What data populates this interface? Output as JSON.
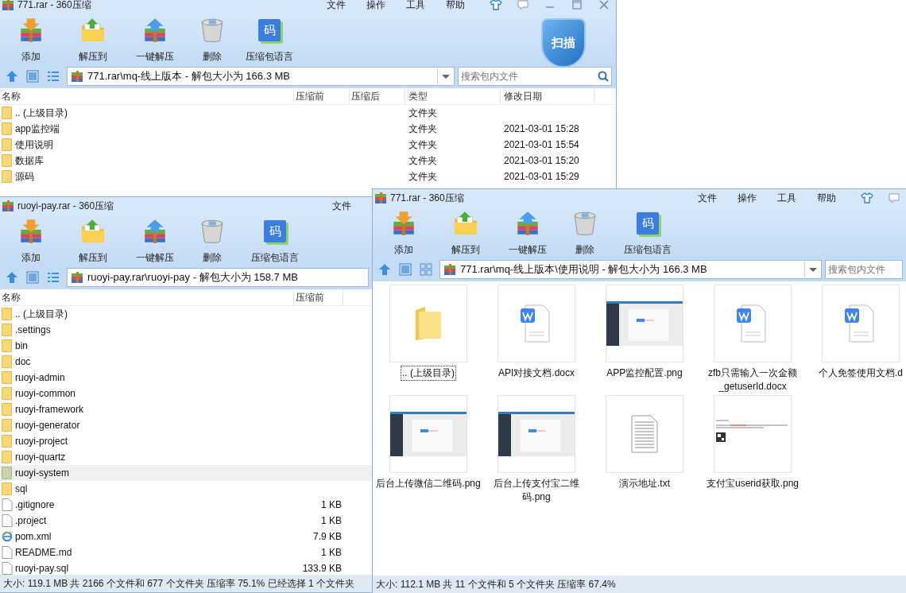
{
  "windows": [
    {
      "title": "771.rar - 360压缩",
      "menu": [
        "文件",
        "操作",
        "工具",
        "帮助"
      ],
      "title_buttons": [
        {
          "kind": "skin"
        },
        {
          "kind": "feedback"
        },
        {
          "kind": "minimize"
        },
        {
          "kind": "maximize"
        },
        {
          "kind": "close"
        }
      ],
      "toolbar": [
        {
          "label": "添加",
          "kind": "add"
        },
        {
          "label": "解压到",
          "kind": "extract"
        },
        {
          "label": "一键解压",
          "kind": "quick"
        },
        {
          "label": "删除",
          "kind": "delete"
        },
        {
          "label": "压缩包语言",
          "kind": "language",
          "glyph": "码"
        }
      ],
      "scan_badge": "扫描",
      "address": "771.rar\\mq-线上版本 - 解包大小为 166.3 MB",
      "search": {
        "placeholder": "搜索包内文件"
      },
      "columns": [
        {
          "label": "名称",
          "kind": "name"
        },
        {
          "label": "压缩前",
          "kind": "size"
        },
        {
          "label": "压缩后",
          "kind": "packed"
        },
        {
          "label": "类型",
          "kind": "type"
        },
        {
          "label": "修改日期",
          "kind": "modified"
        }
      ],
      "rows": [
        {
          "name": ".. (上级目录)",
          "kind": "folder",
          "type": "文件夹",
          "selected": false
        },
        {
          "name": "app监控端",
          "kind": "folder",
          "type": "文件夹",
          "modified": "2021-03-01 15:28",
          "selected": false
        },
        {
          "name": "使用说明",
          "kind": "folder",
          "type": "文件夹",
          "modified": "2021-03-01 15:54",
          "selected": false
        },
        {
          "name": "数据库",
          "kind": "folder",
          "type": "文件夹",
          "modified": "2021-03-01 15:20",
          "selected": false
        },
        {
          "name": "源码",
          "kind": "folder",
          "type": "文件夹",
          "modified": "2021-03-01 15:29",
          "selected": false
        }
      ]
    },
    {
      "title": "ruoyi-pay.rar - 360压缩",
      "menu": [
        "文件"
      ],
      "toolbar": [
        {
          "label": "添加",
          "kind": "add"
        },
        {
          "label": "解压到",
          "kind": "extract"
        },
        {
          "label": "一键解压",
          "kind": "quick"
        },
        {
          "label": "删除",
          "kind": "delete"
        },
        {
          "label": "压缩包语言",
          "kind": "language",
          "glyph": "码"
        }
      ],
      "address": "ruoyi-pay.rar\\ruoyi-pay - 解包大小为 158.7 MB",
      "columns": [
        {
          "label": "名称",
          "kind": "name"
        },
        {
          "label": "压缩前",
          "kind": "size"
        }
      ],
      "rows": [
        {
          "name": ".. (上级目录)",
          "kind": "folder",
          "selected": false
        },
        {
          "name": ".settings",
          "kind": "folder",
          "selected": false
        },
        {
          "name": "bin",
          "kind": "folder",
          "selected": false
        },
        {
          "name": "doc",
          "kind": "folder",
          "selected": false
        },
        {
          "name": "ruoyi-admin",
          "kind": "folder",
          "selected": false
        },
        {
          "name": "ruoyi-common",
          "kind": "folder",
          "selected": false
        },
        {
          "name": "ruoyi-framework",
          "kind": "folder",
          "selected": false
        },
        {
          "name": "ruoyi-generator",
          "kind": "folder",
          "selected": false
        },
        {
          "name": "ruoyi-project",
          "kind": "folder",
          "selected": false
        },
        {
          "name": "ruoyi-quartz",
          "kind": "folder",
          "selected": false
        },
        {
          "name": "ruoyi-system",
          "kind": "folder",
          "selected": true
        },
        {
          "name": "sql",
          "kind": "folder",
          "selected": false
        },
        {
          "name": ".gitignore",
          "kind": "file",
          "size": "1 KB",
          "selected": false
        },
        {
          "name": ".project",
          "kind": "file",
          "size": "1 KB",
          "selected": false
        },
        {
          "name": "pom.xml",
          "kind": "web",
          "size": "7.9 KB",
          "selected": false
        },
        {
          "name": "README.md",
          "kind": "file",
          "size": "1 KB",
          "selected": false
        },
        {
          "name": "ruoyi-pay.sql",
          "kind": "file",
          "size": "133.9 KB",
          "selected": false
        }
      ],
      "status": "大小: 119.1 MB 共 2166 个文件和 677 个文件夹 压缩率 75.1% 已经选择 1 个文件夹"
    },
    {
      "title": "771.rar - 360压缩",
      "menu": [
        "文件",
        "操作",
        "工具",
        "帮助"
      ],
      "title_buttons": [
        {
          "kind": "skin"
        },
        {
          "kind": "feedback"
        }
      ],
      "toolbar": [
        {
          "label": "添加",
          "kind": "add"
        },
        {
          "label": "解压到",
          "kind": "extract"
        },
        {
          "label": "一键解压",
          "kind": "quick"
        },
        {
          "label": "删除",
          "kind": "delete"
        },
        {
          "label": "压缩包语言",
          "kind": "language",
          "glyph": "码"
        }
      ],
      "address": "771.rar\\mq-线上版本\\使用说明 - 解包大小为 166.3 MB",
      "search": {
        "placeholder": "搜索包内文件"
      },
      "items": [
        {
          "name": ".. (上级目录)",
          "kind": "folder",
          "selected": true
        },
        {
          "name": "API对接文档.docx",
          "kind": "doc",
          "selected": false
        },
        {
          "name": "APP监控配置.png",
          "kind": "image",
          "selected": false
        },
        {
          "name": "zfb只需输入一次金额_getuserId.docx",
          "kind": "doc",
          "selected": false
        },
        {
          "name": "个人免签使用文档.d",
          "kind": "doc",
          "selected": false
        },
        {
          "name": "后台上传微信二维码.png",
          "kind": "image",
          "selected": false
        },
        {
          "name": "后台上传支付宝二维码.png",
          "kind": "image",
          "selected": false
        },
        {
          "name": "演示地址.txt",
          "kind": "text",
          "selected": false
        },
        {
          "name": "支付宝userid获取.png",
          "kind": "qr-image",
          "selected": false
        }
      ],
      "status": "大小: 112.1 MB 共 11 个文件和 5 个文件夹 压缩率 67.4%"
    }
  ]
}
